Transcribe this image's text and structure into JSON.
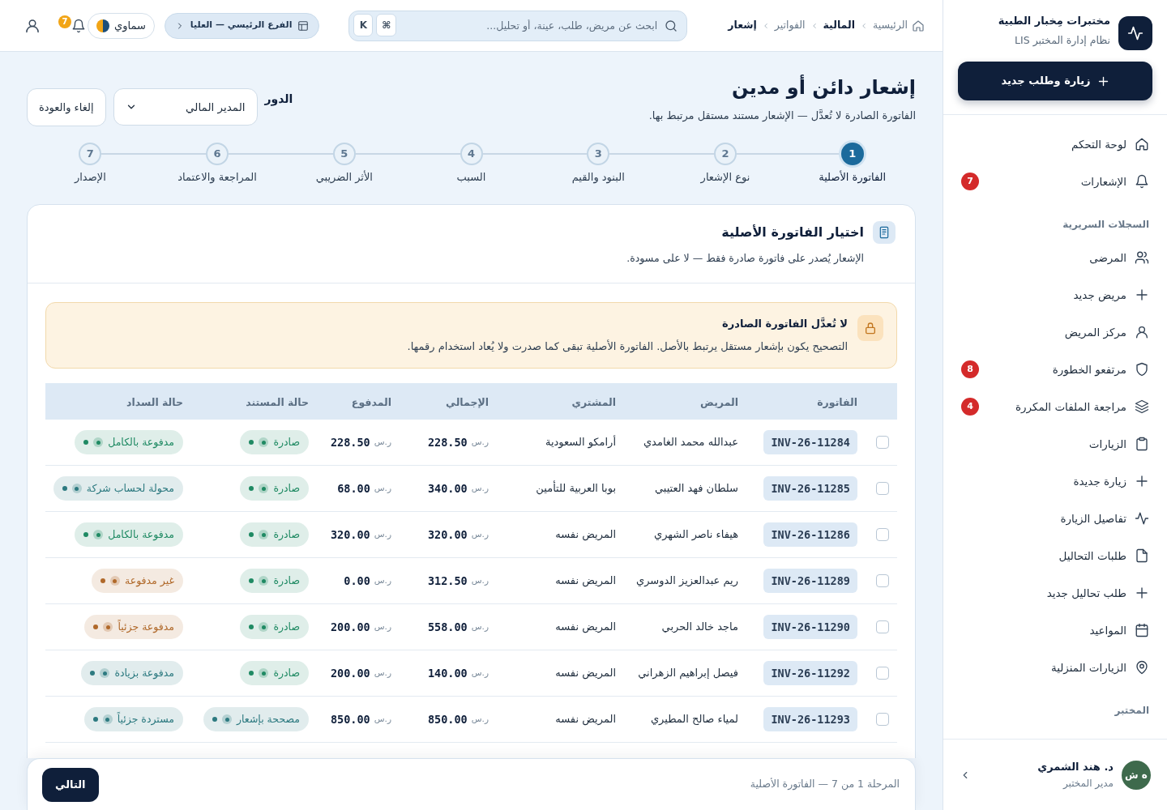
{
  "sidebar": {
    "brand": {
      "title": "مختبرات مِخبار الطبية",
      "subtitle": "نظام إدارة المختبر LIS"
    },
    "action_button": "زيارة وطلب جديد",
    "groups": [
      {
        "items": [
          {
            "label": "لوحة التحكم",
            "selected": false
          },
          {
            "label": "الإشعارات",
            "selected": false,
            "badge": "7"
          }
        ]
      },
      {
        "heading": "السجلات السريرية",
        "items": [
          {
            "label": "المرضى",
            "selected": false
          },
          {
            "label": "مريض جديد",
            "selected": false
          },
          {
            "label": "مركز المريض",
            "selected": false
          },
          {
            "label": "مرتفعو الخطورة",
            "selected": false,
            "badge": "8"
          },
          {
            "label": "مراجعة الملفات المكررة",
            "selected": false,
            "badge": "4"
          },
          {
            "label": "الزيارات",
            "selected": false
          },
          {
            "label": "زيارة جديدة",
            "selected": false
          },
          {
            "label": "تفاصيل الزيارة",
            "selected": false
          },
          {
            "label": "طلبات التحاليل",
            "selected": false
          },
          {
            "label": "طلب تحاليل جديد",
            "selected": false
          },
          {
            "label": "المواعيد",
            "selected": false
          },
          {
            "label": "الزيارات المنزلية",
            "selected": false
          }
        ]
      },
      {
        "heading": "المختبر"
      }
    ],
    "user": {
      "initials": "ه ش",
      "name": "د. هند الشمري",
      "role": "مدير المختبر"
    }
  },
  "top_bar": {
    "breadcrumbs": [
      {
        "label": "الرئيسية",
        "bold": false
      },
      {
        "label": "المالية",
        "bold": true
      },
      {
        "label": "الفواتير",
        "bold": false
      },
      {
        "label": "إشعار",
        "bold": true
      }
    ],
    "search": {
      "placeholder": "ابحث عن مريض، طلب، عينة، أو تحليل...",
      "shortcut": [
        "⌘",
        "K"
      ]
    },
    "branch": "الفرع الرئيسي — العليا",
    "theme": "سماوي",
    "notifications_badge": "7"
  },
  "page": {
    "title": "إشعار دائن أو مدين",
    "subtitle": "الفاتورة الصادرة لا تُعدَّل — الإشعار مستند مستقل مرتبط بها.",
    "role": {
      "label": "الدور",
      "value": "المدير المالي"
    },
    "cancel_button": "إلغاء والعودة"
  },
  "steps": [
    {
      "number": "1",
      "label": "الفاتورة الأصلية",
      "selected": true
    },
    {
      "number": "2",
      "label": "نوع الإشعار",
      "selected": false
    },
    {
      "number": "3",
      "label": "البنود والقيم",
      "selected": false
    },
    {
      "number": "4",
      "label": "السبب",
      "selected": false
    },
    {
      "number": "5",
      "label": "الأثر الضريبي",
      "selected": false
    },
    {
      "number": "6",
      "label": "المراجعة والاعتماد",
      "selected": false
    },
    {
      "number": "7",
      "label": "الإصدار",
      "selected": false
    }
  ],
  "card": {
    "title": "اختيار الفاتورة الأصلية",
    "subtitle": "الإشعار يُصدر على فاتورة صادرة فقط — لا على مسودة.",
    "alert": {
      "title": "لا تُعدَّل الفاتورة الصادرة",
      "text": "التصحيح يكون بإشعار مستقل يرتبط بالأصل. الفاتورة الأصلية تبقى كما صدرت ولا يُعاد استخدام رقمها."
    },
    "table": {
      "columns": [
        "الفاتورة",
        "المريض",
        "المشتري",
        "الإجمالي",
        "المدفوع",
        "حالة المستند",
        "حالة السداد"
      ],
      "rows": [
        {
          "selected": false,
          "invoice": "INV-26-11284",
          "patient": "عبدالله محمد الغامدي",
          "buyer": "أرامكو السعودية",
          "total": {
            "currency": "ر.س",
            "value": "228.50"
          },
          "paid": {
            "currency": "ر.س",
            "value": "228.50"
          },
          "document_status": {
            "label": "صادرة",
            "color": "#1f8a63"
          },
          "payment_status": {
            "label": "مدفوعة بالكامل",
            "color": "#1f8a63"
          }
        },
        {
          "selected": false,
          "invoice": "INV-26-11285",
          "patient": "سلطان فهد العتيبي",
          "buyer": "بوبا العربية للتأمين",
          "total": {
            "currency": "ر.س",
            "value": "340.00"
          },
          "paid": {
            "currency": "ر.س",
            "value": "68.00"
          },
          "document_status": {
            "label": "صادرة",
            "color": "#1f8a63"
          },
          "payment_status": {
            "label": "محولة لحساب شركة",
            "color": "#2d7a80"
          }
        },
        {
          "selected": false,
          "invoice": "INV-26-11286",
          "patient": "هيفاء ناصر الشهري",
          "buyer": "المريض نفسه",
          "total": {
            "currency": "ر.س",
            "value": "320.00"
          },
          "paid": {
            "currency": "ر.س",
            "value": "320.00"
          },
          "document_status": {
            "label": "صادرة",
            "color": "#1f8a63"
          },
          "payment_status": {
            "label": "مدفوعة بالكامل",
            "color": "#1f8a63"
          }
        },
        {
          "selected": false,
          "invoice": "INV-26-11289",
          "patient": "ريم عبدالعزيز الدوسري",
          "buyer": "المريض نفسه",
          "total": {
            "currency": "ر.س",
            "value": "312.50"
          },
          "paid": {
            "currency": "ر.س",
            "value": "0.00"
          },
          "document_status": {
            "label": "صادرة",
            "color": "#1f8a63"
          },
          "payment_status": {
            "label": "غير مدفوعة",
            "color": "#b0692a"
          }
        },
        {
          "selected": false,
          "invoice": "INV-26-11290",
          "patient": "ماجد خالد الحربي",
          "buyer": "المريض نفسه",
          "total": {
            "currency": "ر.س",
            "value": "558.00"
          },
          "paid": {
            "currency": "ر.س",
            "value": "200.00"
          },
          "document_status": {
            "label": "صادرة",
            "color": "#1f8a63"
          },
          "payment_status": {
            "label": "مدفوعة جزئياً",
            "color": "#b0692a"
          }
        },
        {
          "selected": false,
          "invoice": "INV-26-11292",
          "patient": "فيصل إبراهيم الزهراني",
          "buyer": "المريض نفسه",
          "total": {
            "currency": "ر.س",
            "value": "140.00"
          },
          "paid": {
            "currency": "ر.س",
            "value": "200.00"
          },
          "document_status": {
            "label": "صادرة",
            "color": "#1f8a63"
          },
          "payment_status": {
            "label": "مدفوعة بزيادة",
            "color": "#2d7a80"
          }
        },
        {
          "selected": false,
          "invoice": "INV-26-11293",
          "patient": "لمياء صالح المطيري",
          "buyer": "المريض نفسه",
          "total": {
            "currency": "ر.س",
            "value": "850.00"
          },
          "paid": {
            "currency": "ر.س",
            "value": "850.00"
          },
          "document_status": {
            "label": "مصححة بإشعار",
            "color": "#2d7a80"
          },
          "payment_status": {
            "label": "مستردة جزئياً",
            "color": "#2d7a80"
          }
        }
      ]
    }
  },
  "footer": {
    "progress": "المرحلة 1 من 7 — الفاتورة الأصلية",
    "next_button": "التالي"
  }
}
